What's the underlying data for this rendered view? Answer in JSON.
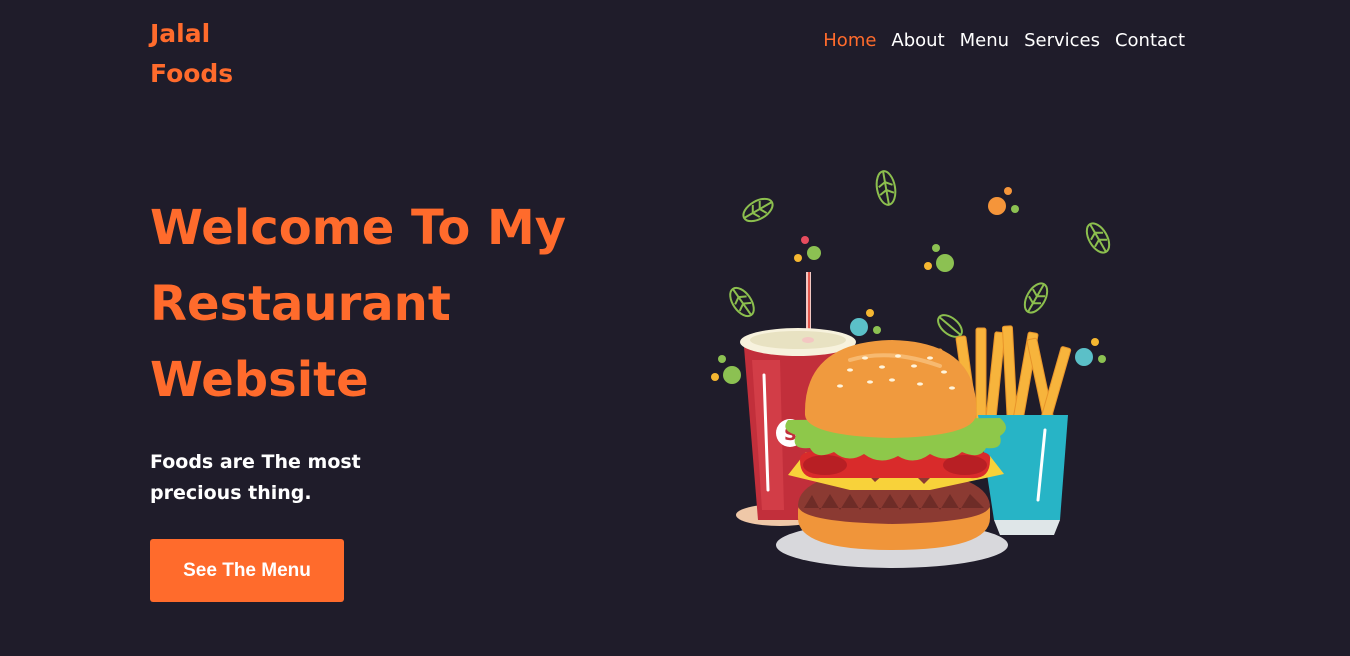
{
  "brand": {
    "name": "Jalal Foods"
  },
  "nav": {
    "items": [
      {
        "label": "Home",
        "active": true
      },
      {
        "label": "About",
        "active": false
      },
      {
        "label": "Menu",
        "active": false
      },
      {
        "label": "Services",
        "active": false
      },
      {
        "label": "Contact",
        "active": false
      }
    ]
  },
  "hero": {
    "title": "Welcome To My Restaurant Website",
    "tagline": "Foods are The most precious thing.",
    "cta_label": "See The Menu"
  },
  "colors": {
    "background": "#1f1c2a",
    "accent": "#ff6b2c",
    "text": "#ffffff"
  },
  "icons": {
    "hero_image": "burger-fries-drink-illustration"
  }
}
